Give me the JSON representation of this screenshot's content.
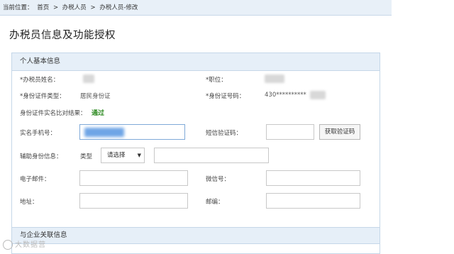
{
  "breadcrumb": {
    "prefix": "当前位置：",
    "home": "首页",
    "sep1": ">",
    "level1": "办税人员",
    "sep2": ">",
    "current": "办税人员-修改"
  },
  "page_title": "办税员信息及功能授权",
  "personal_panel": {
    "title": "个人基本信息",
    "name_label": "*办税员姓名：",
    "position_label": "*职位：",
    "id_type_label": "*身份证件类型：",
    "id_type_value": "居民身份证",
    "id_no_label": "*身份证号码：",
    "id_no_value": "430**********",
    "verify_label": "身份证件实名比对结果：",
    "verify_value": "通过",
    "phone_label": "实名手机号：",
    "sms_label": "短信验证码：",
    "sms_button": "获取验证码",
    "aux_label": "辅助身份信息：",
    "aux_type_label": "类型",
    "aux_type_select": "请选择",
    "email_label": "电子邮件：",
    "wechat_label": "微信号：",
    "address_label": "地址：",
    "postcode_label": "邮编："
  },
  "company_panel": {
    "title": "与企业关联信息"
  },
  "watermark": "大数据营"
}
